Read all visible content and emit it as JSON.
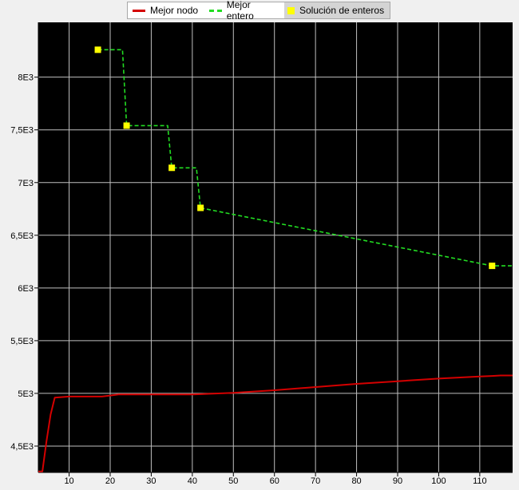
{
  "legend": {
    "items": [
      {
        "label": "Mejor nodo",
        "color": "#d40000",
        "symbol": "line"
      },
      {
        "label": "Mejor entero",
        "color": "#22dd22",
        "symbol": "dashed-line"
      },
      {
        "label": "Solución de enteros",
        "color": "#ffff00",
        "symbol": "square"
      }
    ]
  },
  "chart_data": {
    "type": "line",
    "background": "#000000",
    "grid": true,
    "xlim": [
      2.5,
      118
    ],
    "ylim": [
      4250,
      8520
    ],
    "xticks": [
      10,
      20,
      30,
      40,
      50,
      60,
      70,
      80,
      90,
      100,
      110
    ],
    "xtick_labels": [
      "10",
      "20",
      "30",
      "40",
      "50",
      "60",
      "70",
      "80",
      "90",
      "100",
      "110"
    ],
    "yticks": [
      4500,
      5000,
      5500,
      6000,
      6500,
      7000,
      7500,
      8000
    ],
    "ytick_labels": [
      "4,5E3",
      "5E3",
      "5,5E3",
      "6E3",
      "6,5E3",
      "7E3",
      "7,5E3",
      "8E3"
    ],
    "legend_position": "top-center",
    "series": [
      {
        "name": "Mejor nodo",
        "style": "solid",
        "color": "#d40000",
        "x": [
          2.5,
          3.5,
          4.5,
          5.5,
          6.5,
          10,
          15,
          18,
          20,
          22,
          30,
          40,
          50,
          60,
          70,
          80,
          90,
          100,
          110,
          113,
          115,
          118
        ],
        "y": [
          4260,
          4260,
          4550,
          4800,
          4960,
          4970,
          4970,
          4970,
          4980,
          4990,
          4990,
          4990,
          5005,
          5030,
          5060,
          5090,
          5115,
          5140,
          5160,
          5165,
          5170,
          5170
        ]
      },
      {
        "name": "Mejor entero",
        "style": "dashed",
        "color": "#22dd22",
        "x": [
          17,
          23,
          24,
          34,
          35,
          41,
          42,
          113,
          118
        ],
        "y": [
          8260,
          8260,
          7540,
          7540,
          7140,
          7140,
          6760,
          6210,
          6210
        ]
      },
      {
        "name": "Solución de enteros",
        "style": "markers",
        "color": "#ffff00",
        "x": [
          17,
          24,
          35,
          42,
          113
        ],
        "y": [
          8260,
          7540,
          7140,
          6760,
          6210
        ]
      }
    ]
  }
}
